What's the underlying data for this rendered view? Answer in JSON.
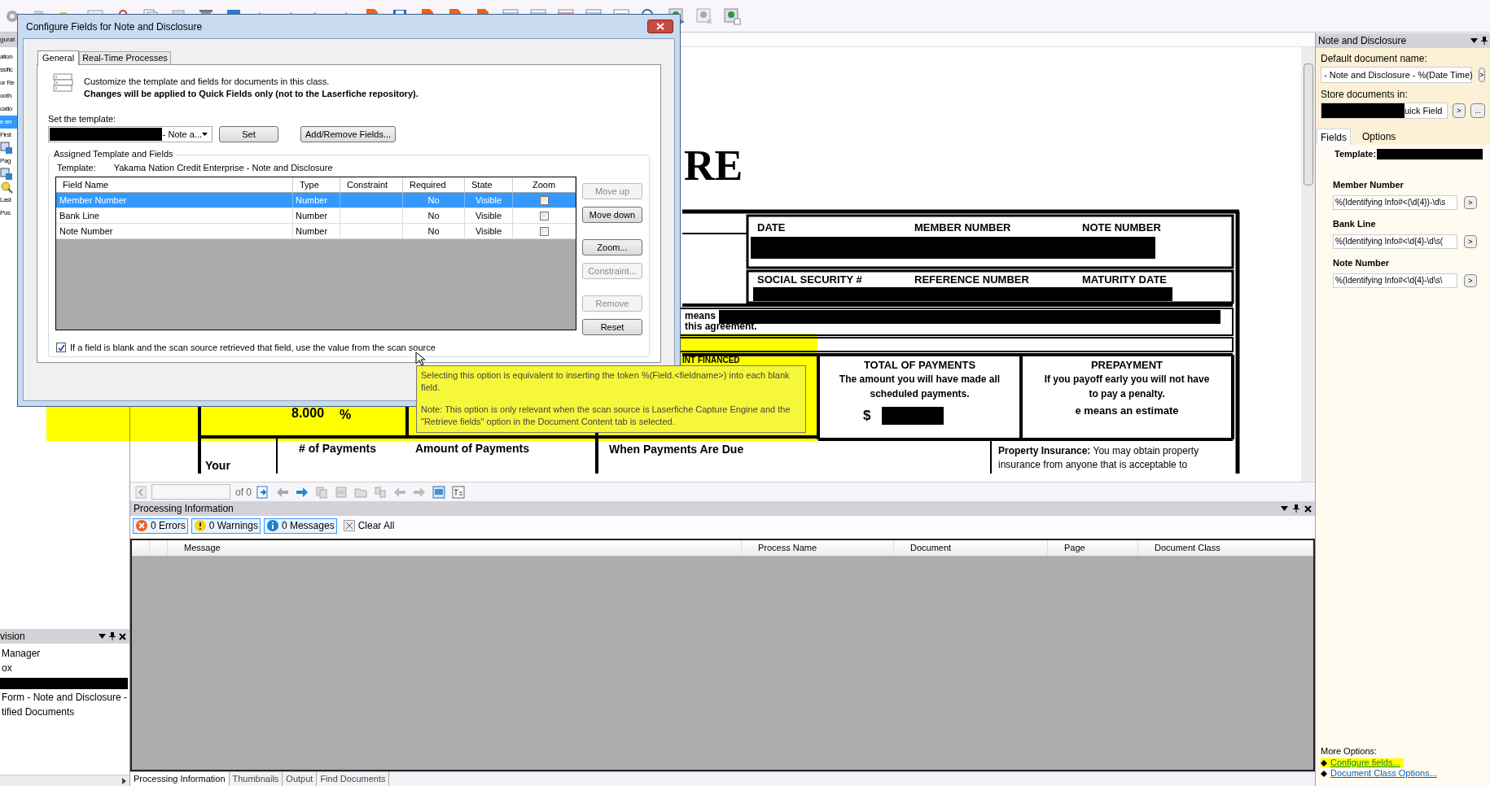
{
  "left_panel": {
    "title": "gurat",
    "items": [
      {
        "kind": "text",
        "label": "ation",
        "selected": false
      },
      {
        "kind": "text",
        "label": "ssific",
        "selected": false
      },
      {
        "kind": "text",
        "label": "or Re",
        "selected": false
      },
      {
        "kind": "text",
        "label": "ooth",
        "selected": false
      },
      {
        "kind": "text",
        "label": "catio",
        "selected": false
      },
      {
        "kind": "text",
        "label": "e an",
        "selected": true
      },
      {
        "kind": "text",
        "label": "First",
        "selected": false
      },
      {
        "kind": "icon",
        "selected": false
      },
      {
        "kind": "text",
        "label": "Pag",
        "selected": false
      },
      {
        "kind": "icon",
        "selected": false
      },
      {
        "kind": "search",
        "selected": false
      },
      {
        "kind": "text",
        "label": "Last",
        "selected": false
      },
      {
        "kind": "text",
        "label": "Pos",
        "selected": false
      }
    ]
  },
  "left_lower_panel": {
    "title": "vision",
    "items": [
      {
        "kind": "text",
        "label": "Manager"
      },
      {
        "kind": "text",
        "label": "ox"
      },
      {
        "kind": "redacted"
      },
      {
        "kind": "text",
        "label": "Form - Note and Disclosure -"
      },
      {
        "kind": "text",
        "label": "tified Documents"
      }
    ]
  },
  "document": {
    "texts": [
      "RE",
      "DATE",
      "MEMBER NUMBER",
      "NOTE NUMBER",
      "SOCIAL SECURITY #",
      "REFERENCE NUMBER",
      "MATURITY DATE",
      "means",
      "this agreement.",
      "INT FINANCED",
      "TOTAL OF PAYMENTS",
      "The amount you will have made all",
      "scheduled payments.",
      "$",
      "PREPAYMENT",
      "If you payoff early you will not have",
      "to pay a penalty.",
      "e means an estimate",
      "8.000",
      "%",
      "# of Payments",
      "Amount of Payments",
      "When Payments Are Due",
      "Your",
      "**Property Insurance:** You may obtain property insurance from anyone that is acceptable to"
    ],
    "page_count": "of 0"
  },
  "processing": {
    "title": "Processing Information",
    "filters": [
      {
        "kind": "error",
        "label": "0 Errors"
      },
      {
        "kind": "warning",
        "label": "0 Warnings"
      },
      {
        "kind": "info",
        "label": "0 Messages"
      }
    ],
    "clear_all": "Clear All",
    "columns": [
      "Message",
      "Process Name",
      "Document",
      "Page",
      "Document Class"
    ],
    "bottom_tabs": [
      {
        "label": "Processing Information",
        "selected": true
      },
      {
        "label": "Thumbnails",
        "selected": false
      },
      {
        "label": "Output",
        "selected": false
      },
      {
        "label": "Find Documents",
        "selected": false
      }
    ]
  },
  "right_panel": {
    "title": "Note and Disclosure",
    "default_name_label": "Default document name:",
    "default_name_value": "- Note and Disclosure - %(Date Time)",
    "default_name_button": ">",
    "store_label": "Store documents in:",
    "store_value": "uick Field",
    "store_buttons": [
      ">",
      "..."
    ],
    "tabs": [
      {
        "label": "Fields",
        "selected": true
      },
      {
        "label": "Options",
        "selected": false
      }
    ],
    "template_label": "Template:",
    "fields": [
      {
        "label": "Member Number",
        "value": "%(Identifying Info#<(\\d{4})-\\d\\s",
        "button": ">"
      },
      {
        "label": "Bank Line",
        "value": "%(Identifying Info#<\\d{4}-\\d\\s(",
        "button": ">"
      },
      {
        "label": "Note Number",
        "value": "%(Identifying Info#<\\d{4}-\\d\\s\\",
        "button": ">"
      }
    ],
    "more_options": "More Options:",
    "links": [
      {
        "label": "Configure fields...",
        "highlighted": true
      },
      {
        "label": "Document Class Options...",
        "highlighted": false
      }
    ]
  },
  "dialog": {
    "title": "Configure Fields for Note and Disclosure",
    "tabs": [
      {
        "label": "General",
        "selected": true
      },
      {
        "label": "Real-Time Processes",
        "selected": false
      }
    ],
    "intro": "Customize the template and fields for documents in this class.",
    "intro_note": "Changes will be applied to Quick Fields only (not to the Laserfiche repository).",
    "template_label": "Set the template:",
    "template_value": "- Note a...",
    "set_button": "Set",
    "add_remove_button": "Add/Remove Fields...",
    "group_title": "Assigned Template and Fields",
    "template_caption": "Template:",
    "template_name": "Yakama Nation Credit Enterprise - Note and Disclosure",
    "columns": [
      "Field Name",
      "Type",
      "Constraint",
      "Required",
      "State",
      "Zoom"
    ],
    "rows": [
      {
        "field_name": "Member Number",
        "type": "Number",
        "required": "No",
        "state": "Visible",
        "zoom": false,
        "selected": true
      },
      {
        "field_name": "Bank Line",
        "type": "Number",
        "required": "No",
        "state": "Visible",
        "zoom": false,
        "selected": false
      },
      {
        "field_name": "Note Number",
        "type": "Number",
        "required": "No",
        "state": "Visible",
        "zoom": false,
        "selected": false
      }
    ],
    "side_buttons": [
      {
        "label": "Move up",
        "disabled": true
      },
      {
        "label": "Move down",
        "disabled": false
      },
      {
        "label": "Zoom...",
        "disabled": false
      },
      {
        "label": "Constraint...",
        "disabled": true
      },
      {
        "label": "Remove",
        "disabled": true
      },
      {
        "label": "Reset",
        "disabled": false
      }
    ],
    "fallback_option": {
      "label": "If a field is blank and the scan source retrieved that field, use the value from the scan source",
      "checked": true
    },
    "tooltip": [
      "Selecting this option is equivalent to inserting the token %(Field.<fieldname>) into each blank field.",
      "Note: This option is only relevant when the scan source is Laserfiche Capture Engine and the \"Retrieve fields\" option in the Document Content tab is selected."
    ]
  }
}
